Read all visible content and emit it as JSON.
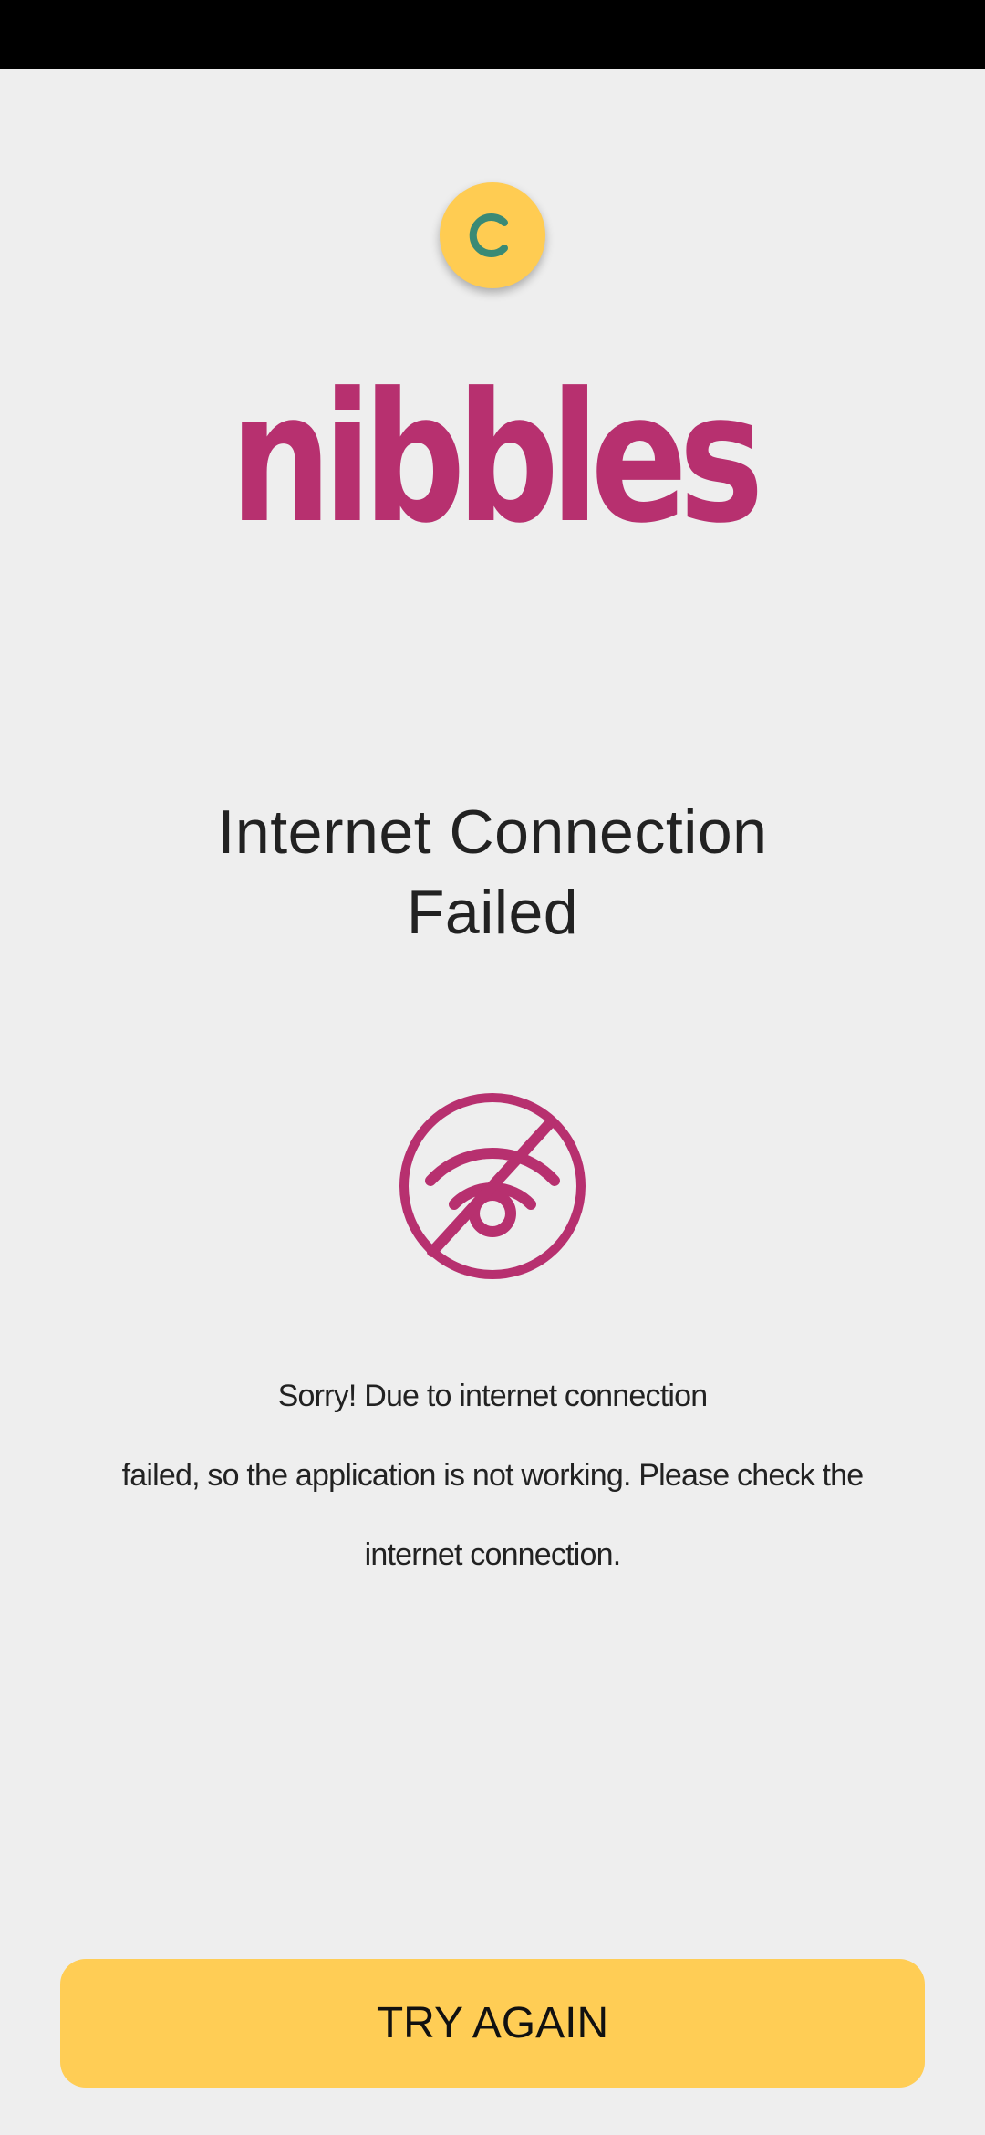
{
  "app": {
    "logo_text": "nibbles"
  },
  "error": {
    "title_line1": "Internet Connection",
    "title_line2": "Failed",
    "icon": "no-wifi-icon",
    "message_line1": "Sorry! Due to internet connection",
    "message_line2": "failed, so the application is not working. Please check the",
    "message_line3": "internet connection."
  },
  "actions": {
    "retry_label": "TRY AGAIN"
  },
  "loading": {
    "icon": "loading-spinner-icon"
  },
  "colors": {
    "brand": "#b7306f",
    "accent": "#ffcd55",
    "spinner_arc": "#3a8a75",
    "background": "#eeeeee",
    "text": "#222222"
  }
}
